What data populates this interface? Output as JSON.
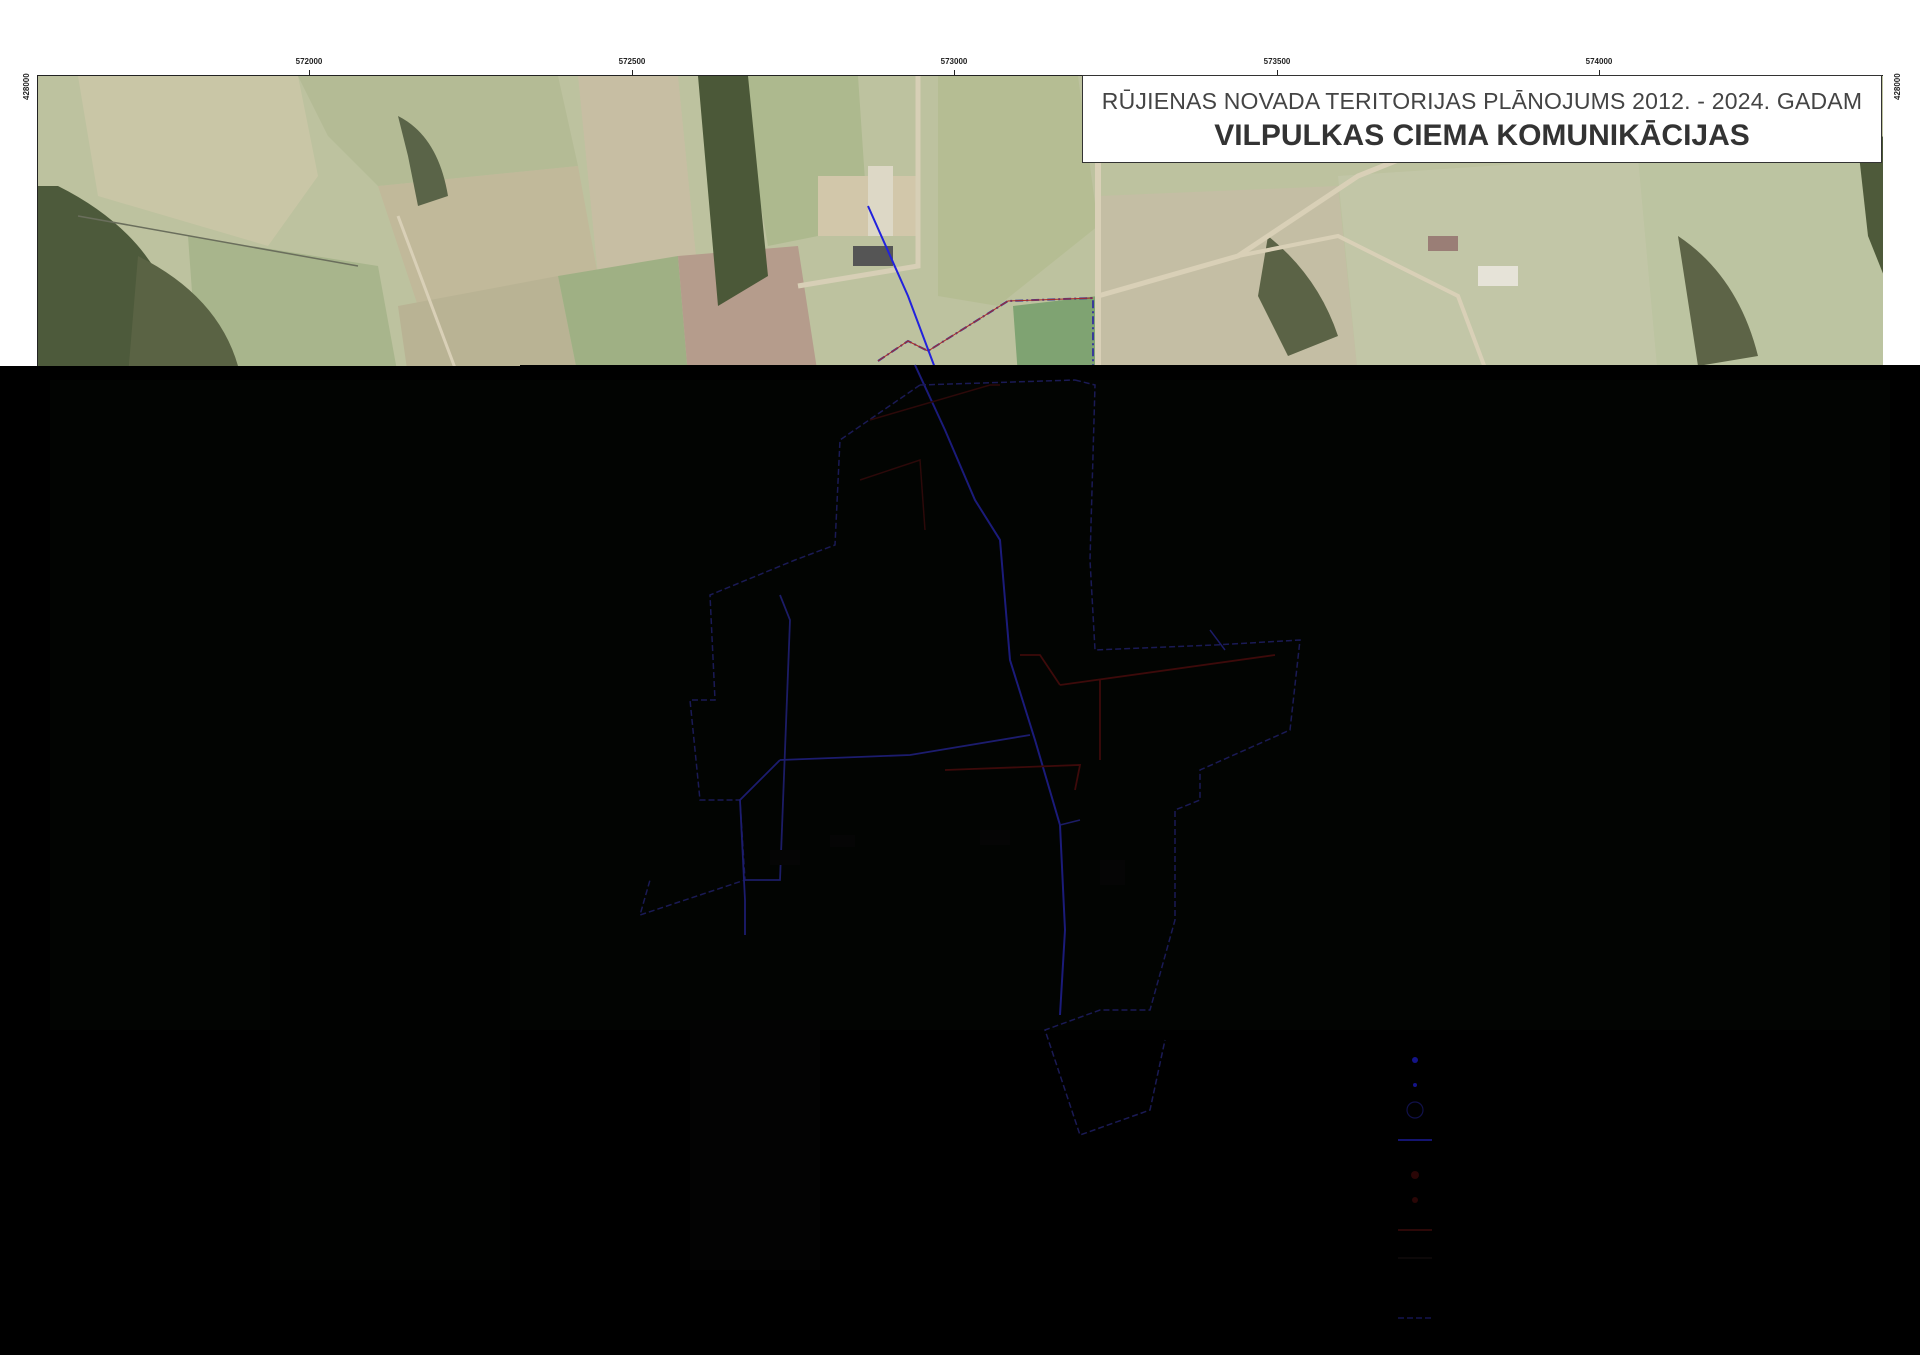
{
  "map": {
    "title_line1": "RŪJIENAS NOVADA TERITORIJAS PLĀNOJUMS 2012. - 2024. GADAM",
    "title_line2": "VILPULKAS CIEMA KOMUNIKĀCIJAS"
  },
  "grid": {
    "x_ticks": [
      "572000",
      "572500",
      "573000",
      "573500",
      "574000"
    ],
    "y_tick_left": "428000",
    "y_tick_right": "428000"
  },
  "colors": {
    "water_line": "#2222dd",
    "sewer_line": "#bb1111",
    "boundary": "#3333aa"
  }
}
